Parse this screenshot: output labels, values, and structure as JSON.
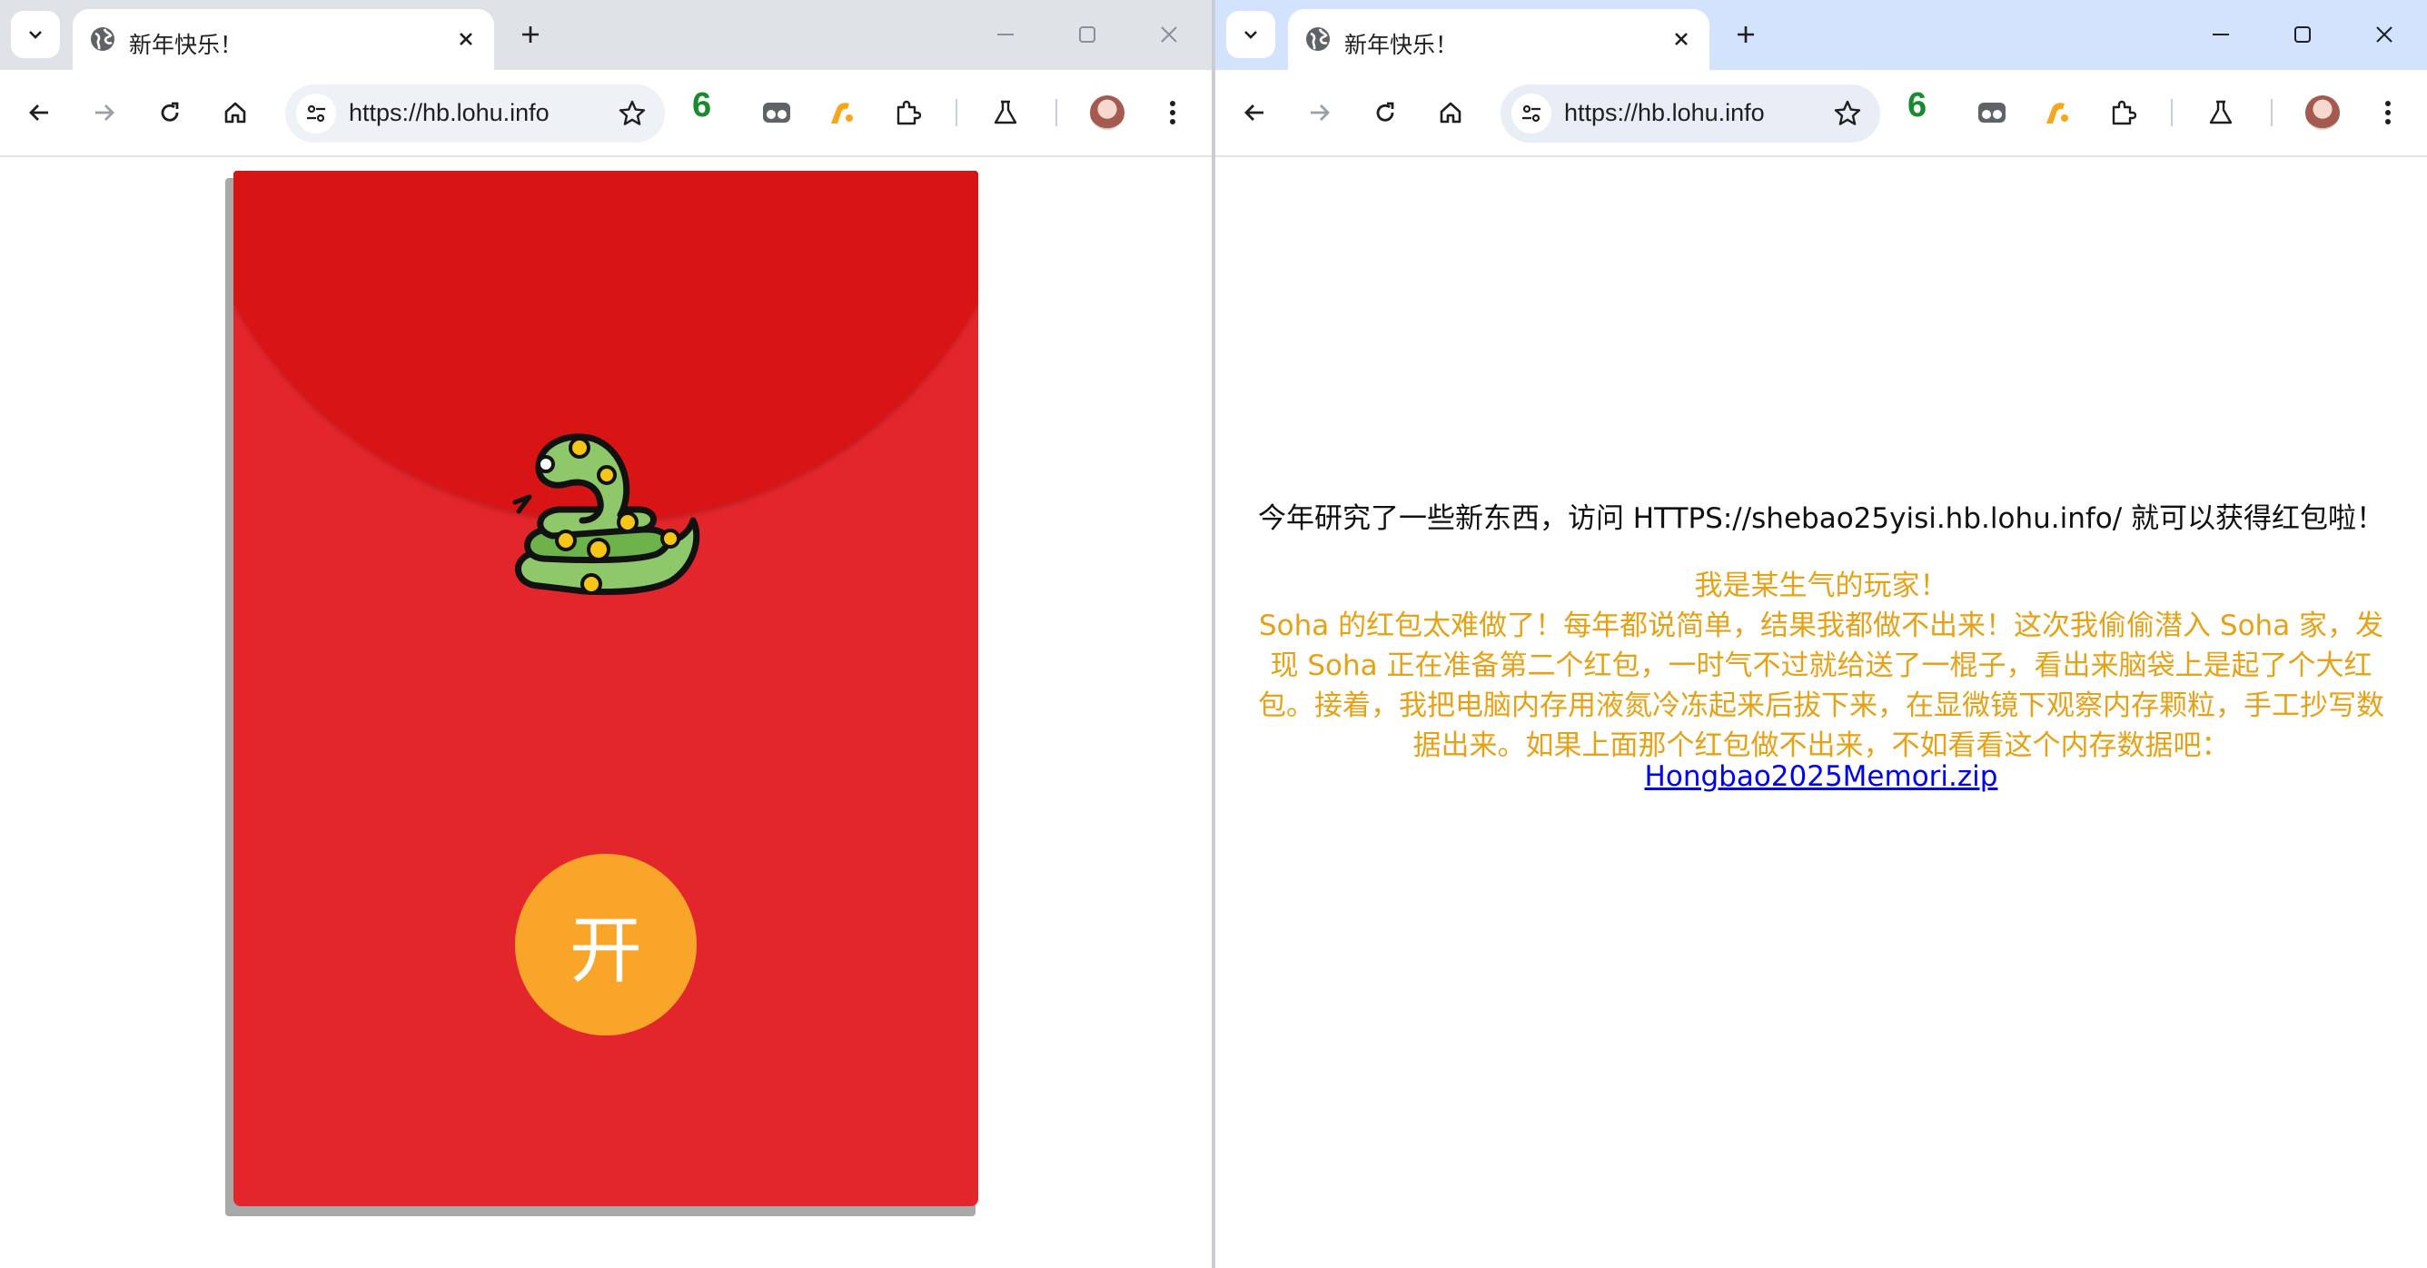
{
  "left_window": {
    "tab_title": "新年快乐！",
    "url": "https://hb.lohu.info",
    "extension_badge": "6",
    "envelope": {
      "button_label": "开",
      "colors": {
        "body": "#e3262c",
        "flap": "#d91414",
        "button": "#f8a52a"
      },
      "illustration": "snake-icon"
    }
  },
  "right_window": {
    "tab_title": "新年快乐！",
    "url": "https://hb.lohu.info",
    "extension_badge": "6",
    "content": {
      "line1": "今年研究了一些新东西，访问 HTTPS://shebao25yisi.hb.lohu.info/ 就可以获得红包啦！",
      "note_title": "我是某生气的玩家！",
      "note_lines": [
        "Soha 的红包太难做了！每年都说简单，结果我都做不出来！这次我偷偷潜入 Soha 家，发",
        "现 Soha 正在准备第二个红包，一时气不过就给送了一棍子，看出来脑袋上是起了个大红",
        "包。接着，我把电脑内存用液氮冷冻起来后拔下来，在显微镜下观察内存颗粒，手工抄写数",
        "据出来。如果上面那个红包做不出来，不如看看这个内存数据吧："
      ],
      "link_text": "Hongbao2025Memori.zip",
      "colors": {
        "note": "#e5a216",
        "link": "#0000ee"
      }
    }
  }
}
